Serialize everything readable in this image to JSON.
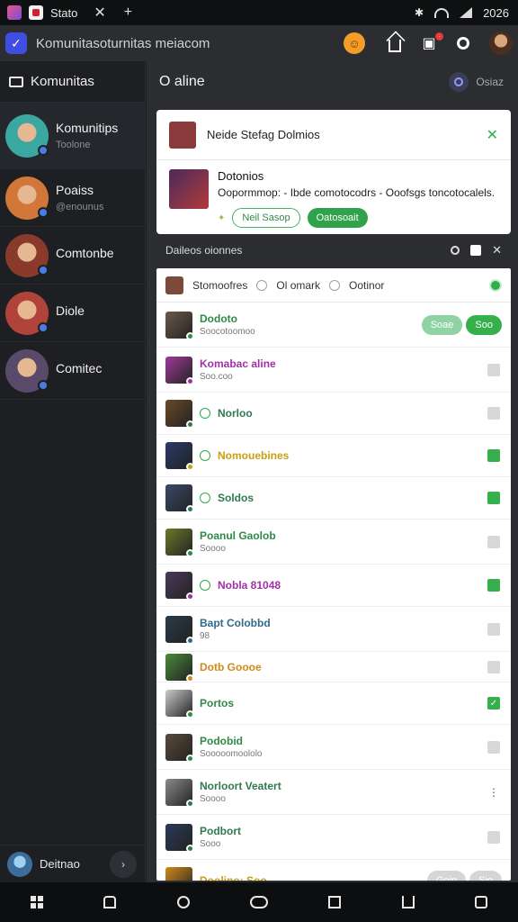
{
  "status_bar": {
    "tab_title": "Stato",
    "time": "2026"
  },
  "address_bar": {
    "url": "Komunitasoturnitas meiacom"
  },
  "sidebar": {
    "header": "Komunitas",
    "items": [
      {
        "name": "Komunitips",
        "sub": "Toolone",
        "avatar_color": "#3aa7a1"
      },
      {
        "name": "Poaiss",
        "sub": "@enounus",
        "avatar_color": "#d1773a"
      },
      {
        "name": "Comtonbe",
        "sub": "",
        "avatar_color": "#8a3a2a"
      },
      {
        "name": "Diole",
        "sub": "",
        "avatar_color": "#b0433a"
      },
      {
        "name": "Comitec",
        "sub": "",
        "avatar_color": "#5a4a6a"
      }
    ],
    "footer_name": "Deitnao"
  },
  "main": {
    "title": "O aline",
    "header_right": "Osiaz",
    "notification": {
      "title": "Neide Stefag Dolmios",
      "item_title": "Dotonios",
      "item_desc": "Oopormmop: - Ibde comotocodrs - Ooofsgs toncotocalels.",
      "btn_secondary": "Neil Sasop",
      "btn_primary": "Oatosoait"
    },
    "filter_label": "Daileos oionnes",
    "list_header": {
      "col1": "Stomoofres",
      "col2": "Ol omark",
      "col3": "Ootinor"
    },
    "rows": [
      {
        "name": "Dodoto",
        "sub": "Soocotoomoo",
        "color": "#2f8a44",
        "thumb": "#6b5a4a",
        "btns": [
          "Soae",
          "Soo"
        ]
      },
      {
        "name": "Komabac aline",
        "sub": "Soo.coo",
        "color": "#a12fa8",
        "thumb": "#a03a9a",
        "check": "off"
      },
      {
        "name": "Norloo",
        "sub": "",
        "color": "#2f7a4f",
        "thumb": "#6a4a2a",
        "check": "off"
      },
      {
        "name": "Nomouebines",
        "sub": "",
        "color": "#c7a011",
        "thumb": "#2a3a6a",
        "check": "on"
      },
      {
        "name": "Soldos",
        "sub": "",
        "color": "#2f7a4f",
        "thumb": "#3a4a6a",
        "check": "on"
      },
      {
        "name": "Poanul Gaolob",
        "sub": "Soooo",
        "color": "#2f8a44",
        "thumb": "#6a7a2a",
        "check": "off"
      },
      {
        "name": "Nobla 81048",
        "sub": "",
        "color": "#a12fa8",
        "thumb": "#4a3a5a",
        "check": "on"
      },
      {
        "name": "Bapt Colobbd",
        "sub": "98",
        "color": "#2f6a8a",
        "thumb": "#2a3a4a",
        "check": "off"
      },
      {
        "name": "Dotb Goooe",
        "sub": "",
        "color": "#d08a1a",
        "thumb": "#4a8a3a",
        "check": "off"
      },
      {
        "name": "Portos",
        "sub": "",
        "color": "#2f8a44",
        "thumb": "#cccccc",
        "check": "tick"
      },
      {
        "name": "Podobid",
        "sub": "Sooooomoololo",
        "color": "#2f8a44",
        "thumb": "#5a4a3a",
        "check": "off"
      },
      {
        "name": "Norloort Veatert",
        "sub": "Soooo",
        "color": "#2f7a4f",
        "thumb": "#8a8a8a",
        "check": "menu"
      },
      {
        "name": "Podbort",
        "sub": "Sooo",
        "color": "#2f7a4f",
        "thumb": "#2a3a5a",
        "check": "off"
      },
      {
        "name": "Doolino: Soo",
        "sub": "",
        "color": "#c7a011",
        "thumb": "#d08a1a",
        "btns": [
          "Goin",
          "Sio"
        ]
      }
    ]
  }
}
